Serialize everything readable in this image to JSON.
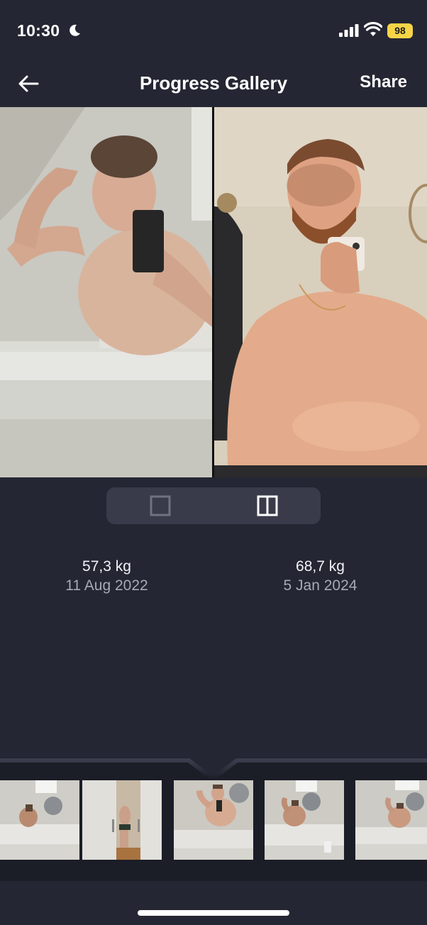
{
  "status_bar": {
    "time": "10:30",
    "battery": "98",
    "moon_icon": "moon-icon",
    "signal_icon": "cellular-signal-icon",
    "wifi_icon": "wifi-icon"
  },
  "nav": {
    "back_icon": "arrow-left-icon",
    "title": "Progress Gallery",
    "share_label": "Share"
  },
  "compare": {
    "left_photo": {
      "description_icon": "progress-photo"
    },
    "right_photo": {
      "description_icon": "progress-photo"
    }
  },
  "view_toggle": {
    "options": [
      {
        "icon": "single-view-icon",
        "selected": false
      },
      {
        "icon": "split-view-icon",
        "selected": true
      }
    ]
  },
  "stats": [
    {
      "weight": "57,3 kg",
      "date": "11 Aug 2022"
    },
    {
      "weight": "68,7 kg",
      "date": "5 Jan 2024"
    }
  ],
  "thumbnails": {
    "count": 5,
    "selected_index": 2
  },
  "colors": {
    "background": "#242633",
    "toggle_bg": "#393b4a",
    "battery": "#f5d547",
    "muted_text": "#a7a9b6"
  }
}
